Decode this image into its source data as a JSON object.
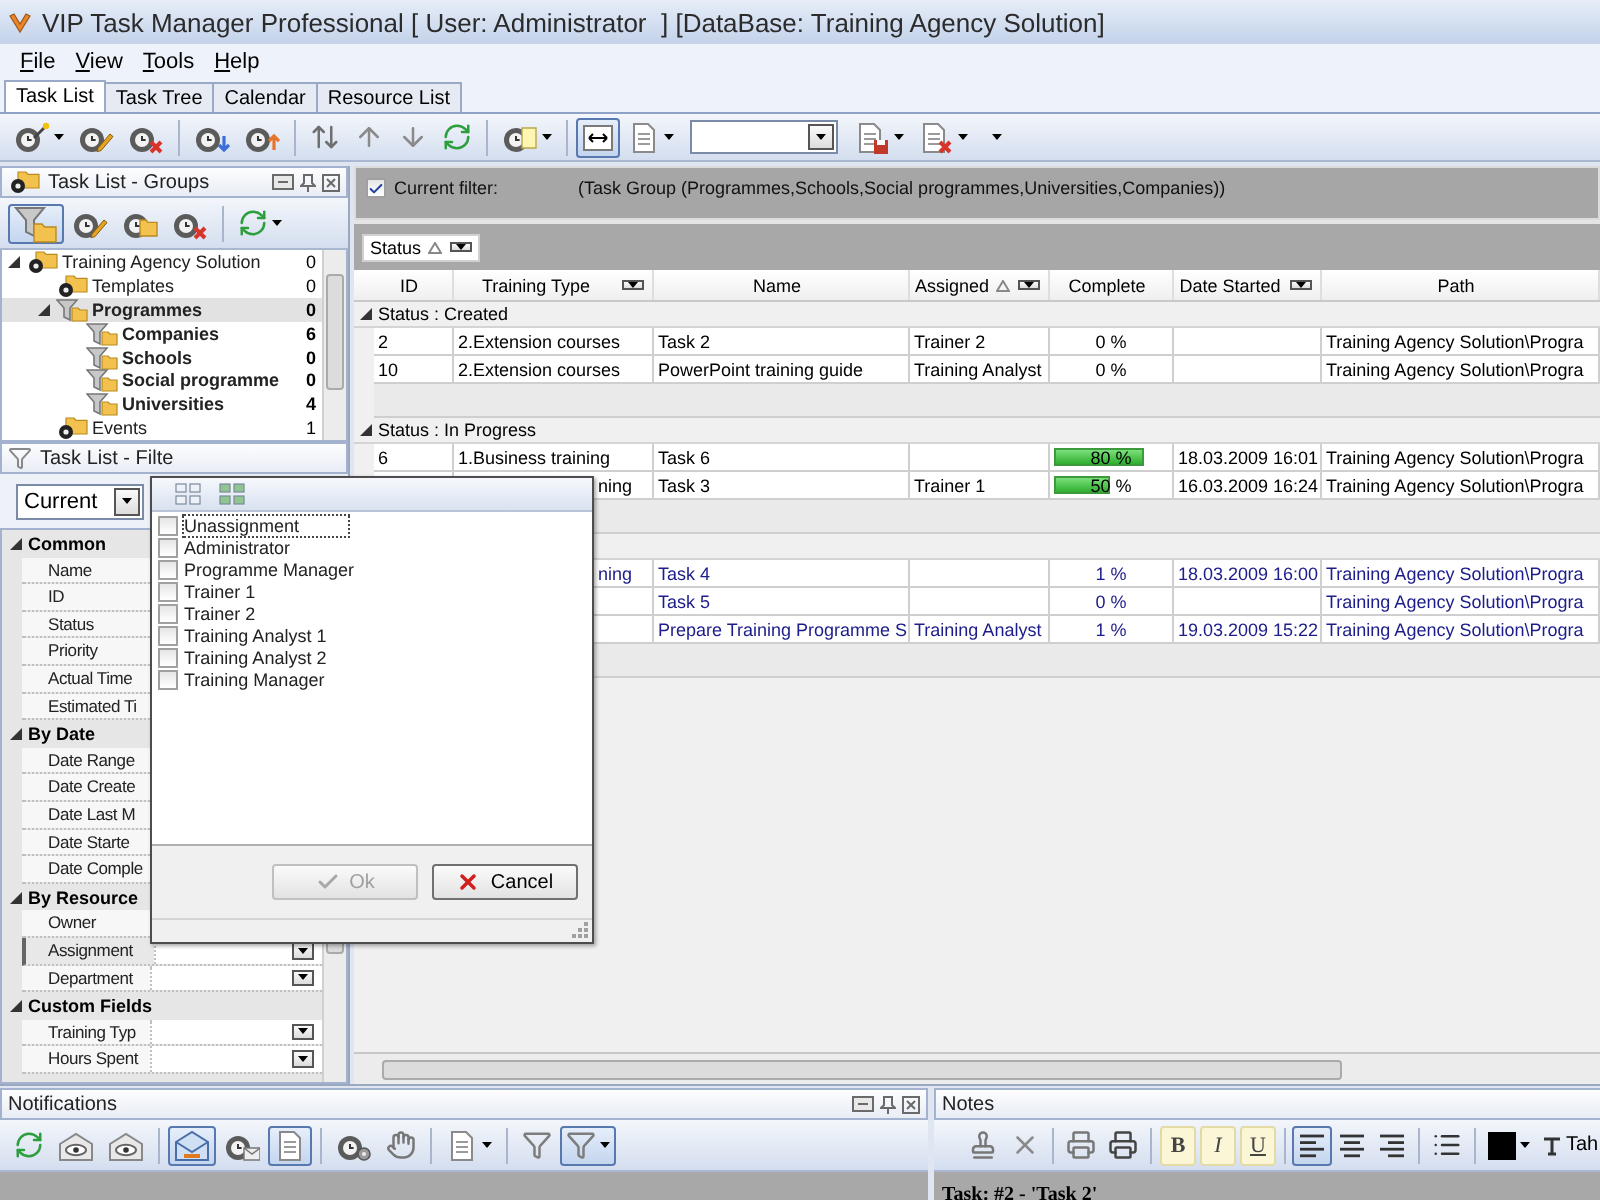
{
  "window": {
    "title": "VIP Task Manager Professional [ User: Administrator  ] [DataBase: Training Agency Solution]"
  },
  "menu": [
    {
      "label": "File"
    },
    {
      "label": "View"
    },
    {
      "label": "Tools"
    },
    {
      "label": "Help"
    }
  ],
  "tabs": [
    {
      "label": "Task List",
      "selected": true
    },
    {
      "label": "Task Tree",
      "selected": false
    },
    {
      "label": "Calendar",
      "selected": false
    },
    {
      "label": "Resource List",
      "selected": false
    }
  ],
  "toolbar": [
    {
      "kind": "task_new",
      "pressed": false,
      "dropdown": true
    },
    {
      "kind": "task_edit",
      "pressed": false
    },
    {
      "kind": "task_delete",
      "pressed": false
    },
    {
      "kind": "separator"
    },
    {
      "kind": "task_down",
      "pressed": false
    },
    {
      "kind": "task_up",
      "pressed": false
    },
    {
      "kind": "separator"
    },
    {
      "kind": "move",
      "pressed": false
    },
    {
      "kind": "move_up",
      "pressed": false
    },
    {
      "kind": "move_down",
      "pressed": false
    },
    {
      "kind": "refresh",
      "pressed": false
    },
    {
      "kind": "separator"
    },
    {
      "kind": "note",
      "pressed": false,
      "dropdown": true
    },
    {
      "kind": "separator"
    },
    {
      "kind": "fit_width",
      "pressed": true
    },
    {
      "kind": "columns",
      "pressed": false,
      "dropdown": true
    },
    {
      "kind": "combo"
    },
    {
      "kind": "layout_save",
      "pressed": false,
      "dropdown": true
    },
    {
      "kind": "layout_delete",
      "pressed": false,
      "dropdown": true
    },
    {
      "kind": "overflow",
      "pressed": false,
      "dropdown": true
    }
  ],
  "groups_panel": {
    "title": "Task List - Groups",
    "toolbar": [
      {
        "kind": "filter_toggle",
        "pressed": true
      },
      {
        "kind": "group_edit",
        "pressed": false
      },
      {
        "kind": "group_folder",
        "pressed": false
      },
      {
        "kind": "group_delete",
        "pressed": false
      },
      {
        "kind": "separator"
      },
      {
        "kind": "refresh",
        "pressed": false,
        "dropdown": true
      }
    ],
    "tree": [
      {
        "label": "Training Agency Solution",
        "count": "0",
        "kind": "folder",
        "bold": false,
        "selected": false,
        "expanded": true,
        "children": [
          {
            "label": "Templates",
            "count": "0",
            "kind": "folder",
            "bold": false,
            "selected": false
          },
          {
            "label": "Programmes",
            "count": "0",
            "kind": "filter",
            "bold": true,
            "selected": true,
            "expanded": true,
            "children": [
              {
                "label": "Companies",
                "count": "6",
                "kind": "filter",
                "bold": true,
                "selected": false
              },
              {
                "label": "Schools",
                "count": "0",
                "kind": "filter",
                "bold": true,
                "selected": false
              },
              {
                "label": "Social programme",
                "count": "0",
                "kind": "filter",
                "bold": true,
                "selected": false
              },
              {
                "label": "Universities",
                "count": "4",
                "kind": "filter",
                "bold": true,
                "selected": false
              }
            ]
          },
          {
            "label": "Events",
            "count": "1",
            "kind": "folder",
            "bold": false,
            "selected": false
          }
        ]
      }
    ]
  },
  "filters_panel": {
    "title": "Task List - Filte",
    "view": "Current",
    "categories": [
      {
        "label": "Common",
        "expanded": true,
        "rows": [
          {
            "label": "Name",
            "selected": false
          },
          {
            "label": "ID",
            "selected": false
          },
          {
            "label": "Status",
            "selected": false
          },
          {
            "label": "Priority",
            "selected": false
          },
          {
            "label": "Actual Time",
            "selected": false
          },
          {
            "label": "Estimated Ti",
            "selected": false
          }
        ]
      },
      {
        "label": "By Date",
        "expanded": true,
        "rows": [
          {
            "label": "Date Range",
            "selected": false
          },
          {
            "label": "Date Create",
            "selected": false
          },
          {
            "label": "Date Last M",
            "selected": false
          },
          {
            "label": "Date Starte",
            "selected": false
          },
          {
            "label": "Date Comple",
            "selected": false
          }
        ]
      },
      {
        "label": "By Resource",
        "expanded": true,
        "rows": [
          {
            "label": "Owner",
            "selected": false
          },
          {
            "label": "Assignment",
            "selected": true,
            "dropdown": true
          },
          {
            "label": "Department",
            "selected": false,
            "dropdown": true
          }
        ]
      },
      {
        "label": "Custom Fields",
        "expanded": true,
        "rows": [
          {
            "label": "Training Typ",
            "selected": false,
            "dropdown": true
          },
          {
            "label": "Hours Spent",
            "selected": false,
            "dropdown": true
          }
        ]
      }
    ]
  },
  "filter_bar": {
    "checked": true,
    "label": "Current filter:",
    "expression": "(Task Group  (Programmes,Schools,Social programmes,Universities,Companies))"
  },
  "group_by": [
    {
      "label": "Status",
      "sort_ascending": true
    }
  ],
  "grid": {
    "columns": [
      {
        "label": "ID"
      },
      {
        "label": "Training Type",
        "filter": true
      },
      {
        "label": "Name"
      },
      {
        "label": "Assigned",
        "filter": true,
        "sort_ascending": true
      },
      {
        "label": "Complete"
      },
      {
        "label": "Date Started",
        "filter": true
      },
      {
        "label": "Path"
      }
    ],
    "groups": [
      {
        "label": "Status : Created",
        "expanded": true,
        "rows": [
          {
            "id": "2",
            "training_type": "2.Extension courses",
            "name": "Task 2",
            "assigned": "Trainer 2",
            "complete": "0 %",
            "path": "Training Agency Solution\\Progra",
            "color": "#000000"
          },
          {
            "id": "10",
            "training_type": "2.Extension courses",
            "name": "PowerPoint training guide",
            "assigned": "Training Analyst",
            "complete": "0 %",
            "path": "Training Agency Solution\\Progra",
            "color": "#000000"
          }
        ]
      },
      {
        "label": "Status : In Progress",
        "expanded": true,
        "rows": [
          {
            "id": "6",
            "training_type": "1.Business training",
            "name": "Task 6",
            "complete": "80 %",
            "level": 0.8,
            "date_started": "18.03.2009 16:01",
            "path": "Training Agency Solution\\Progra",
            "color": "#000000"
          },
          {
            "training_type": "ning",
            "overlapped": true,
            "name": "Task 3",
            "assigned": "Trainer 1",
            "complete": "50 %",
            "level": 0.5,
            "date_started": "16.03.2009 16:24",
            "path": "Training Agency Solution\\Progra",
            "color": "#000000"
          }
        ]
      },
      {
        "rows": [
          {
            "training_type": "ning",
            "overlapped": true,
            "name": "Task 4",
            "complete": "1 %",
            "date_started": "18.03.2009 16:00",
            "path": "Training Agency Solution\\Progra",
            "color": "#1c1c8a"
          },
          {
            "name": "Task 5",
            "complete": "0 %",
            "path": "Training Agency Solution\\Progra",
            "color": "#1c1c8a"
          },
          {
            "name": "Prepare Training Programme S",
            "assigned": "Training Analyst",
            "complete": "1 %",
            "date_started": "19.03.2009 15:22",
            "path": "Training Agency Solution\\Progra",
            "color": "#1c1c8a"
          }
        ]
      }
    ]
  },
  "assignment_popup": {
    "toolbar": [
      {
        "kind": "check_all"
      },
      {
        "kind": "check_none"
      }
    ],
    "items": [
      {
        "label": "Unassignment",
        "checked": false,
        "focused": true
      },
      {
        "label": "Administrator",
        "checked": false,
        "focused": false
      },
      {
        "label": "Programme Manager",
        "checked": false,
        "focused": false
      },
      {
        "label": "Trainer 1",
        "checked": false,
        "focused": false
      },
      {
        "label": "Trainer 2",
        "checked": false,
        "focused": false
      },
      {
        "label": "Training Analyst 1",
        "checked": false,
        "focused": false
      },
      {
        "label": "Training Analyst 2",
        "checked": false,
        "focused": false
      },
      {
        "label": "Training Manager",
        "checked": false,
        "focused": false
      }
    ],
    "buttons": [
      {
        "kind": "ok",
        "label": "Ok",
        "disabled": true
      },
      {
        "kind": "cancel",
        "label": "Cancel",
        "disabled": false
      }
    ]
  },
  "notifications": {
    "title": "Notifications",
    "toolbar": [
      {
        "kind": "refresh",
        "pressed": false
      },
      {
        "kind": "mail_eye",
        "pressed": false
      },
      {
        "kind": "mail_eye",
        "pressed": false
      },
      {
        "kind": "separator"
      },
      {
        "kind": "inbox",
        "pressed": true
      },
      {
        "kind": "clock_mail",
        "pressed": false
      },
      {
        "kind": "doc_list",
        "pressed": true
      },
      {
        "kind": "separator"
      },
      {
        "kind": "clock_gear",
        "pressed": false
      },
      {
        "kind": "hand",
        "pressed": false
      },
      {
        "kind": "separator"
      },
      {
        "kind": "columns",
        "pressed": false,
        "dropdown": true
      },
      {
        "kind": "separator"
      },
      {
        "kind": "filter",
        "pressed": false
      },
      {
        "kind": "filter",
        "pressed": true,
        "dropdown": true
      }
    ]
  },
  "notes": {
    "title": "Notes",
    "toolbar": [
      {
        "kind": "stamp",
        "pressed": false
      },
      {
        "kind": "delete",
        "pressed": false
      },
      {
        "kind": "separator"
      },
      {
        "kind": "print_preview",
        "pressed": false
      },
      {
        "kind": "print",
        "pressed": false
      },
      {
        "kind": "separator"
      },
      {
        "kind": "bold",
        "label": "B",
        "pressed": false
      },
      {
        "kind": "italic",
        "label": "I",
        "pressed": false
      },
      {
        "kind": "underline",
        "label": "U",
        "pressed": false
      },
      {
        "kind": "separator"
      },
      {
        "kind": "align_left",
        "pressed": true
      },
      {
        "kind": "align_center",
        "pressed": false
      },
      {
        "kind": "align_right",
        "pressed": false
      },
      {
        "kind": "separator"
      },
      {
        "kind": "bullets",
        "pressed": false
      },
      {
        "kind": "separator"
      },
      {
        "kind": "color",
        "pressed": false,
        "dropdown": true
      },
      {
        "kind": "font",
        "label": "Tah",
        "pressed": false
      }
    ],
    "caption": "Task: #2 - 'Task 2'"
  }
}
